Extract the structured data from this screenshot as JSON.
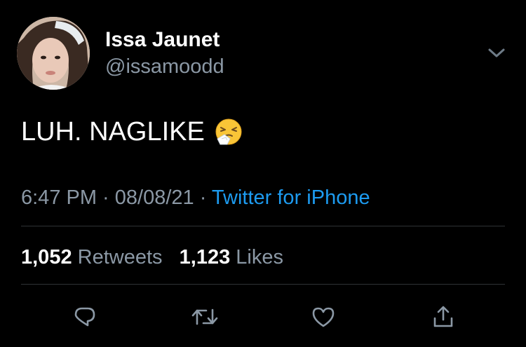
{
  "user": {
    "display_name": "Issa Jaunet",
    "handle": "@issamoodd",
    "avatar_icon": "profile-photo"
  },
  "tweet": {
    "text": "LUH. NAGLIKE",
    "emoji": "sneezing-face-emoji"
  },
  "meta": {
    "time": "6:47 PM",
    "separator1": " · ",
    "date": "08/08/21",
    "separator2": " · ",
    "source": "Twitter for iPhone"
  },
  "stats": {
    "retweets_count": "1,052",
    "retweets_label": "Retweets",
    "likes_count": "1,123",
    "likes_label": "Likes"
  },
  "actions": [
    "reply-icon",
    "retweet-icon",
    "like-icon",
    "share-icon"
  ],
  "colors": {
    "background": "#000000",
    "text": "#ffffff",
    "secondary": "#8b98a5",
    "link": "#1d9bf0",
    "divider": "#2f3336"
  }
}
